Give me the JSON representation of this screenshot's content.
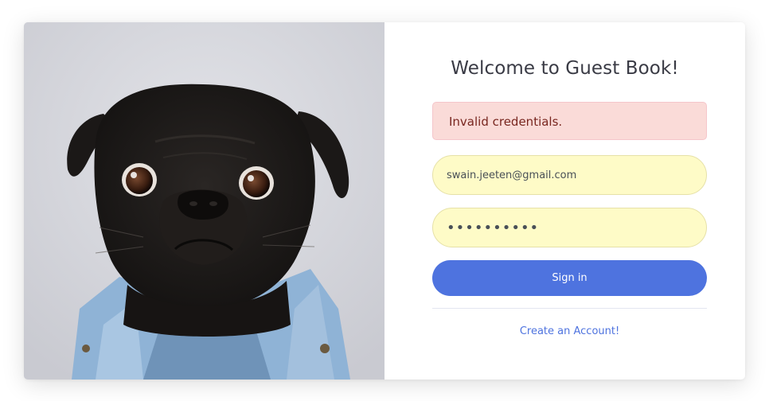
{
  "photo": {
    "description_icon": "pug-in-denim-jacket-image"
  },
  "login": {
    "title": "Welcome to Guest Book!",
    "alert": "Invalid credentials.",
    "email_value": "swain.jeeten@gmail.com",
    "password_value": "••••••••••",
    "sign_in_label": "Sign in",
    "create_account_label": "Create an Account!"
  },
  "colors": {
    "primary": "#4e73df",
    "alert_bg": "#fadbd8",
    "alert_text": "#78261f",
    "autofill_bg": "#fefbc7"
  }
}
